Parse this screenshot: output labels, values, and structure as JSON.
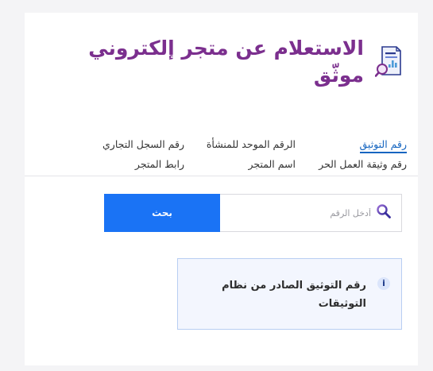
{
  "header": {
    "title": "الاستعلام عن متجر إلكتروني موثّق",
    "icon": "document-search-icon"
  },
  "tabs": [
    {
      "label": "رقم التوثيق",
      "active": true
    },
    {
      "label": "الرقم الموحد للمنشأة",
      "active": false
    },
    {
      "label": "رقم السجل التجاري",
      "active": false
    },
    {
      "label": "رقم وثيقة العمل الحر",
      "active": false
    },
    {
      "label": "اسم المتجر",
      "active": false
    },
    {
      "label": "رابط المتجر",
      "active": false
    }
  ],
  "search": {
    "placeholder": "أدخل الرقم",
    "value": "",
    "button_label": "بحث"
  },
  "info": {
    "text": "رقم التوثيق الصادر من نظام التوثيقات",
    "icon": "info-icon"
  },
  "colors": {
    "title": "#7b2f8e",
    "accent": "#1a73f5",
    "active_tab": "#1565c0"
  }
}
